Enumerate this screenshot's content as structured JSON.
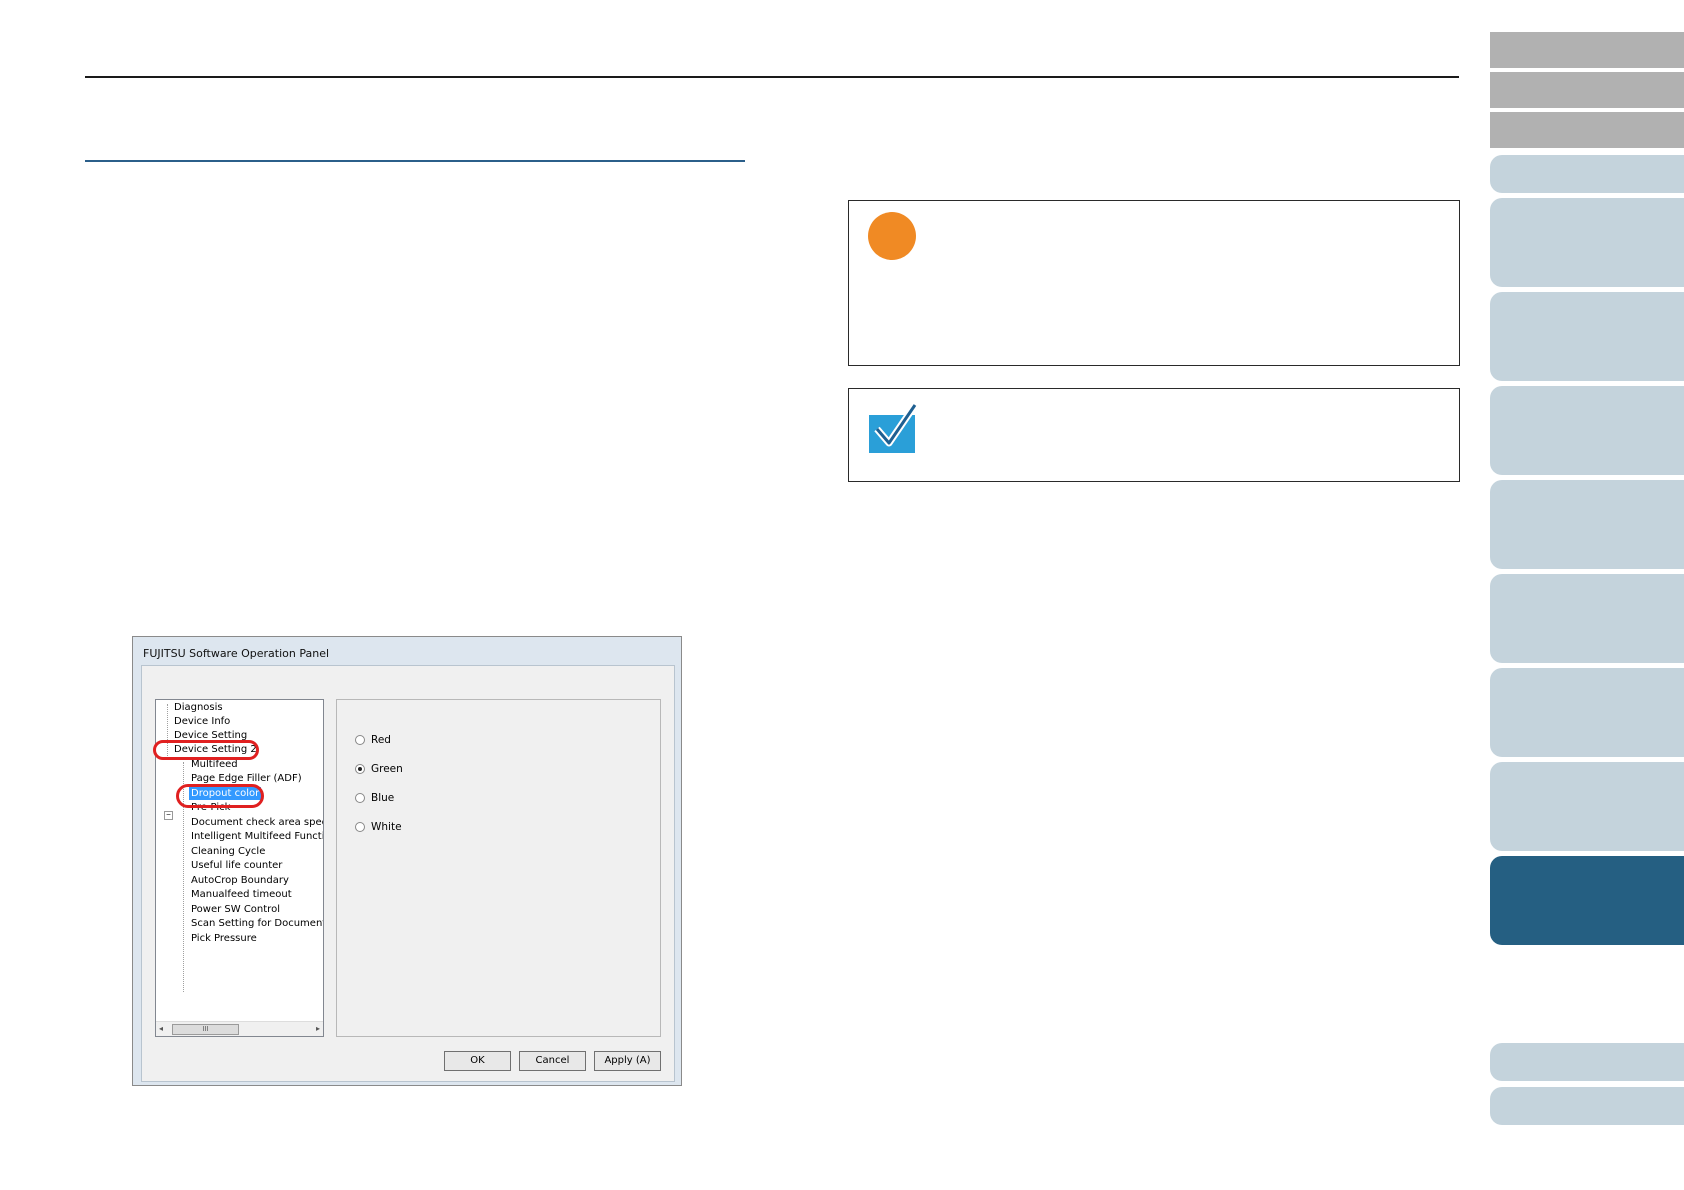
{
  "dialog": {
    "title": "FUJITSU Software Operation Panel",
    "tree_items": [
      "Diagnosis",
      "Device Info",
      "Device Setting",
      "Device Setting 2",
      "Multifeed",
      "Page Edge Filler (ADF)",
      "Dropout color",
      "Pre-Pick",
      "Document check area specific",
      "Intelligent Multifeed Function",
      "Cleaning Cycle",
      "Useful life counter",
      "AutoCrop Boundary",
      "Manualfeed timeout",
      "Power SW Control",
      "Scan Setting for Document wit",
      "Pick Pressure"
    ],
    "selected_item": "Dropout color",
    "scroll_thumb": "III",
    "scroll_left": "◂",
    "scroll_right": "▸",
    "expander_symbol": "−",
    "options": [
      "Red",
      "Green",
      "Blue",
      "White"
    ],
    "selected_option": "Green",
    "buttons": {
      "ok": "OK",
      "cancel": "Cancel",
      "apply": "Apply (A)"
    }
  },
  "colors": {
    "accent_blue": "#255f82",
    "tab_light": "#c4d3dc",
    "tab_gray": "#b1b1b1",
    "important_orange": "#f08a24",
    "highlight_red": "#e02020"
  },
  "icons": {
    "important": "orange-circle-icon",
    "hint": "checkmark-icon"
  }
}
